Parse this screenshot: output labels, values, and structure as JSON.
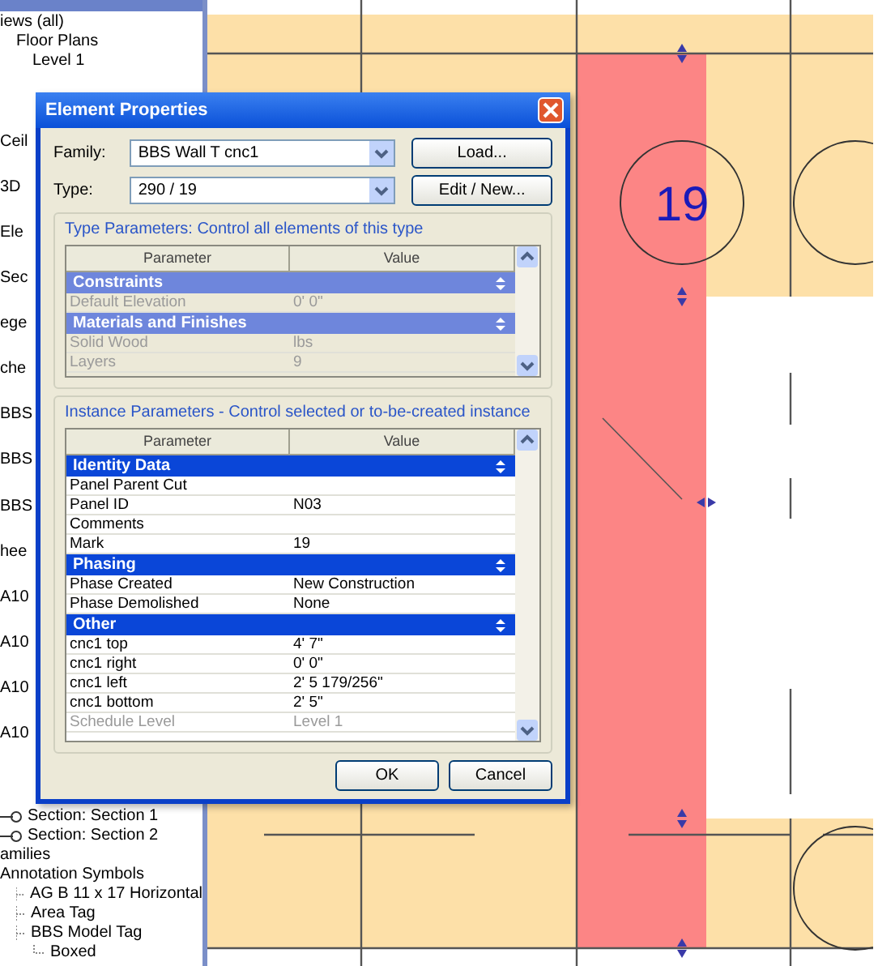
{
  "project_browser": {
    "top_items": [
      {
        "label": "iews (all)",
        "children": [
          {
            "label": "Floor Plans",
            "children": [
              {
                "label": "Level 1"
              }
            ]
          }
        ]
      }
    ],
    "fragments": [
      "Ceil",
      "3D",
      "Ele",
      "Sec",
      "ege",
      "che",
      "BBS",
      "BBS",
      "BBS",
      "hee",
      "A10",
      "A10",
      "A10",
      "A10"
    ],
    "bottom_items": [
      {
        "label": "Section: Section 1",
        "kind": "section"
      },
      {
        "label": "Section: Section 2",
        "kind": "section"
      },
      {
        "label": "amilies",
        "kind": "folder"
      },
      {
        "label": "Annotation Symbols",
        "kind": "folder",
        "children": [
          {
            "label": "AG B 11 x 17 Horizontal",
            "kind": "family"
          },
          {
            "label": "Area Tag",
            "kind": "family"
          },
          {
            "label": "BBS Model Tag",
            "kind": "family",
            "children": [
              {
                "label": "Boxed",
                "kind": "type"
              }
            ]
          }
        ]
      }
    ]
  },
  "plan": {
    "tag": "19"
  },
  "dialog": {
    "title": "Element Properties",
    "fields": [
      {
        "label": "Family:",
        "value": "BBS Wall T cnc1",
        "button": "Load..."
      },
      {
        "label": "Type:",
        "value": "290 / 19",
        "button": "Edit / New..."
      }
    ],
    "type_parameters": {
      "title": "Type Parameters: Control all elements of this type",
      "columns": [
        "Parameter",
        "Value"
      ],
      "rows": [
        {
          "kind": "group",
          "name": "Constraints"
        },
        {
          "kind": "param",
          "name": "Default Elevation",
          "value": "0' 0\"",
          "disabled": true
        },
        {
          "kind": "group",
          "name": "Materials and Finishes"
        },
        {
          "kind": "param",
          "name": "Solid Wood",
          "value": "lbs",
          "disabled": true
        },
        {
          "kind": "param",
          "name": "Layers",
          "value": "9",
          "disabled": true
        }
      ]
    },
    "instance_parameters": {
      "title": "Instance Parameters - Control selected or to-be-created instance",
      "columns": [
        "Parameter",
        "Value"
      ],
      "rows": [
        {
          "kind": "group",
          "name": "Identity Data"
        },
        {
          "kind": "param",
          "name": "Panel Parent Cut",
          "disabled": false
        },
        {
          "kind": "param",
          "name": "Panel ID",
          "value": "N03",
          "disabled": false
        },
        {
          "kind": "param",
          "name": "Comments",
          "disabled": false
        },
        {
          "kind": "param",
          "name": "Mark",
          "value": "19",
          "disabled": false
        },
        {
          "kind": "group",
          "name": "Phasing"
        },
        {
          "kind": "param",
          "name": "Phase Created",
          "value": "New Construction",
          "disabled": false
        },
        {
          "kind": "param",
          "name": "Phase Demolished",
          "value": "None",
          "disabled": false
        },
        {
          "kind": "group",
          "name": "Other"
        },
        {
          "kind": "param",
          "name": "cnc1 top",
          "value": "4' 7\"",
          "disabled": false
        },
        {
          "kind": "param",
          "name": "cnc1 right",
          "value": "0' 0\"",
          "disabled": false
        },
        {
          "kind": "param",
          "name": "cnc1 left",
          "value": "2' 5 179/256\"",
          "disabled": false
        },
        {
          "kind": "param",
          "name": "cnc1 bottom",
          "value": "2' 5\"",
          "disabled": false
        },
        {
          "kind": "param",
          "name": "Schedule Level",
          "value": "Level 1",
          "disabled": true
        }
      ]
    },
    "buttons": [
      "OK",
      "Cancel"
    ]
  }
}
